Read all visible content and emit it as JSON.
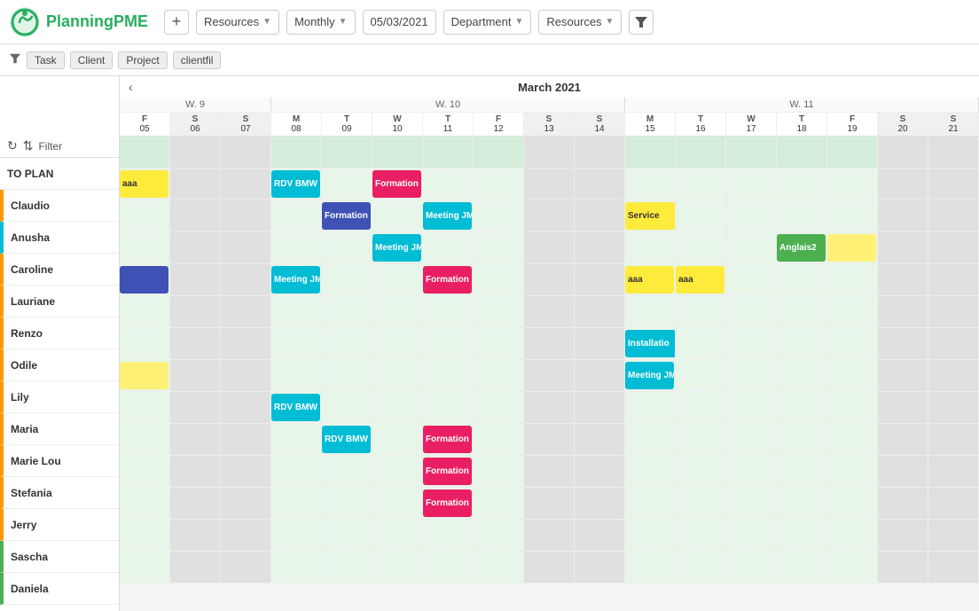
{
  "app": {
    "logo_text": "Planning",
    "logo_pme": "PME",
    "add_label": "+",
    "resources_label": "Resources",
    "monthly_label": "Monthly",
    "date_label": "05/03/2021",
    "department_label": "Department",
    "resources2_label": "Resources",
    "filter_icon": "▼"
  },
  "filter_row": {
    "funnel": "⚗",
    "tags": [
      "Task",
      "Client",
      "Project",
      "clientfil"
    ]
  },
  "left_panel": {
    "refresh_icon": "↻",
    "sort_icon": "⇅",
    "filter_label": "Filter",
    "rows": [
      {
        "name": "TO PLAN",
        "color": ""
      },
      {
        "name": "Claudio",
        "color": "#ff9800"
      },
      {
        "name": "Anusha",
        "color": "#00bcd4"
      },
      {
        "name": "Caroline",
        "color": "#ff9800"
      },
      {
        "name": "Lauriane",
        "color": "#ff9800"
      },
      {
        "name": "Renzo",
        "color": "#ff9800"
      },
      {
        "name": "Odile",
        "color": "#ff9800"
      },
      {
        "name": "Lily",
        "color": "#ff9800"
      },
      {
        "name": "Maria",
        "color": "#ff9800"
      },
      {
        "name": "Marie Lou",
        "color": "#ff9800"
      },
      {
        "name": "Stefania",
        "color": "#ff9800"
      },
      {
        "name": "Jerry",
        "color": "#ff9800"
      },
      {
        "name": "Sascha",
        "color": "#4caf50"
      },
      {
        "name": "Daniela",
        "color": "#4caf50"
      }
    ]
  },
  "calendar": {
    "month_label": "March 2021",
    "nav_left": "‹",
    "weeks": [
      {
        "label": "W. 9",
        "days": [
          {
            "letter": "F",
            "num": "05",
            "weekend": false
          },
          {
            "letter": "S",
            "num": "06",
            "weekend": true
          },
          {
            "letter": "S",
            "num": "07",
            "weekend": true
          }
        ]
      },
      {
        "label": "W. 10",
        "days": [
          {
            "letter": "M",
            "num": "08",
            "weekend": false
          },
          {
            "letter": "T",
            "num": "09",
            "weekend": false
          },
          {
            "letter": "W",
            "num": "10",
            "weekend": false
          },
          {
            "letter": "T",
            "num": "11",
            "weekend": false
          },
          {
            "letter": "F",
            "num": "12",
            "weekend": false
          },
          {
            "letter": "S",
            "num": "13",
            "weekend": true
          },
          {
            "letter": "S",
            "num": "14",
            "weekend": true
          }
        ]
      },
      {
        "label": "W. 11",
        "days": [
          {
            "letter": "M",
            "num": "15",
            "weekend": false
          },
          {
            "letter": "T",
            "num": "16",
            "weekend": false
          },
          {
            "letter": "W",
            "num": "17",
            "weekend": false
          },
          {
            "letter": "T",
            "num": "18",
            "weekend": false
          },
          {
            "letter": "F",
            "num": "19",
            "weekend": false
          },
          {
            "letter": "S",
            "num": "20",
            "weekend": true
          },
          {
            "letter": "S",
            "num": "21",
            "weekend": true
          }
        ]
      }
    ]
  }
}
